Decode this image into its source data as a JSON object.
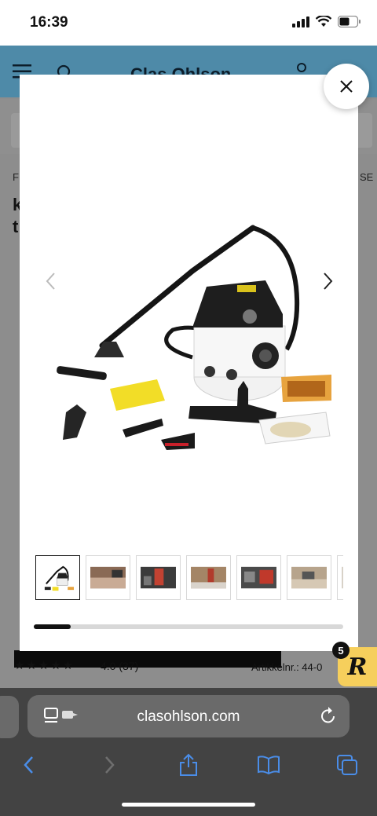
{
  "status_bar": {
    "time": "16:39"
  },
  "background_page": {
    "brand": "Clas Ohlson",
    "left_fragment_row": "F",
    "right_fragment_row": "SE",
    "heading_fragment_1": "k",
    "heading_fragment_2": "t",
    "rating_stars": "★★★★★",
    "rating_value": "4.0",
    "rating_count": "(37)",
    "article_fragment": "Artikkelnr.: 44-0"
  },
  "gallery": {
    "thumbnails": [
      {
        "name": "vacuum-with-accessories"
      },
      {
        "name": "cleaning-sofa"
      },
      {
        "name": "person-cleaning-car-seat"
      },
      {
        "name": "person-in-room"
      },
      {
        "name": "car-interior"
      },
      {
        "name": "cleaning-carpet"
      },
      {
        "name": "partial-thumbnail"
      }
    ],
    "progress_fraction": 0.12
  },
  "extension": {
    "badge_count": "5",
    "letter": "R"
  },
  "browser": {
    "url": "clasohlson.com"
  },
  "colors": {
    "brand_header": "#4e8aa8",
    "extension_yellow": "#f6cf5c",
    "browser_chrome": "#434343",
    "toolbar_icon_blue": "#4a8de8"
  }
}
